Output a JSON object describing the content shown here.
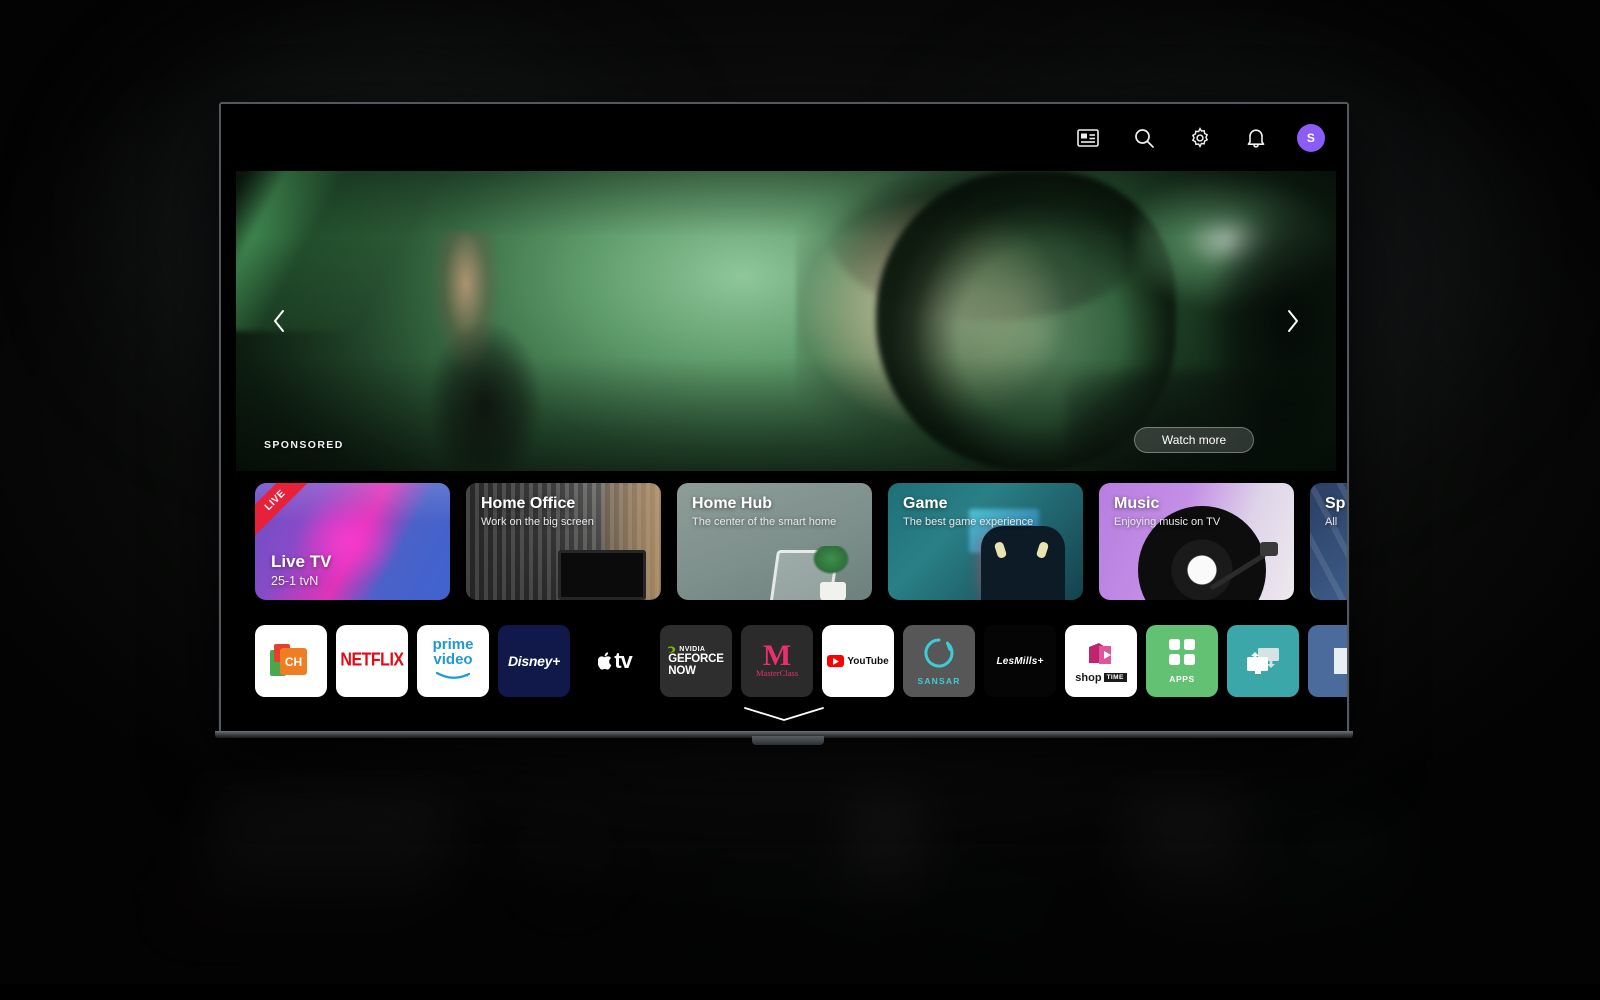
{
  "topbar": {
    "icons": [
      {
        "name": "guide-icon",
        "label": "Guide"
      },
      {
        "name": "search-icon",
        "label": "Search"
      },
      {
        "name": "gear-icon",
        "label": "Settings"
      },
      {
        "name": "bell-icon",
        "label": "Notifications"
      }
    ],
    "avatar_initial": "S",
    "avatar_color": "#8b5cf6"
  },
  "hero": {
    "sponsored_label": "SPONSORED",
    "watch_more_label": "Watch more",
    "prev_label": "Previous",
    "next_label": "Next"
  },
  "tiles": [
    {
      "id": "livetv",
      "title": "Live TV",
      "subtitle": "25-1  tvN",
      "badge": "LIVE"
    },
    {
      "id": "office",
      "title": "Home Office",
      "subtitle": "Work on the big screen"
    },
    {
      "id": "hub",
      "title": "Home Hub",
      "subtitle": "The center of the smart home"
    },
    {
      "id": "game",
      "title": "Game",
      "subtitle": "The best game experience"
    },
    {
      "id": "music",
      "title": "Music",
      "subtitle": "Enjoying music on TV"
    },
    {
      "id": "sports",
      "title": "Sp",
      "subtitle": "All"
    }
  ],
  "apps": [
    {
      "id": "ch",
      "name": "Channel Plus",
      "label": "CH"
    },
    {
      "id": "netflix",
      "name": "Netflix",
      "label": "NETFLIX"
    },
    {
      "id": "prime",
      "name": "Prime Video",
      "label_line1": "prime",
      "label_line2": "video"
    },
    {
      "id": "disney",
      "name": "Disney+",
      "label": "Disney+"
    },
    {
      "id": "appletv",
      "name": "Apple TV",
      "label": "tv"
    },
    {
      "id": "geforce",
      "name": "GeForce Now",
      "label_brand": "NVIDIA",
      "label_line1": "GEFORCE",
      "label_line2": "NOW"
    },
    {
      "id": "master",
      "name": "MasterClass",
      "label_mark": "M",
      "label": "MasterClass"
    },
    {
      "id": "youtube",
      "name": "YouTube",
      "label": "YouTube"
    },
    {
      "id": "sansar",
      "name": "Sansar",
      "label": "SANSAR"
    },
    {
      "id": "lesmills",
      "name": "LesMills+",
      "label": "LesMills+"
    },
    {
      "id": "shoptime",
      "name": "Shop Time",
      "label_line1": "shop",
      "label_line2": "TIME"
    },
    {
      "id": "apps",
      "name": "Apps",
      "label": "APPS"
    },
    {
      "id": "screenshare",
      "name": "Screen Share",
      "label": ""
    },
    {
      "id": "more",
      "name": "More Apps",
      "label": ""
    }
  ],
  "footer": {
    "expand_label": "Show more"
  }
}
